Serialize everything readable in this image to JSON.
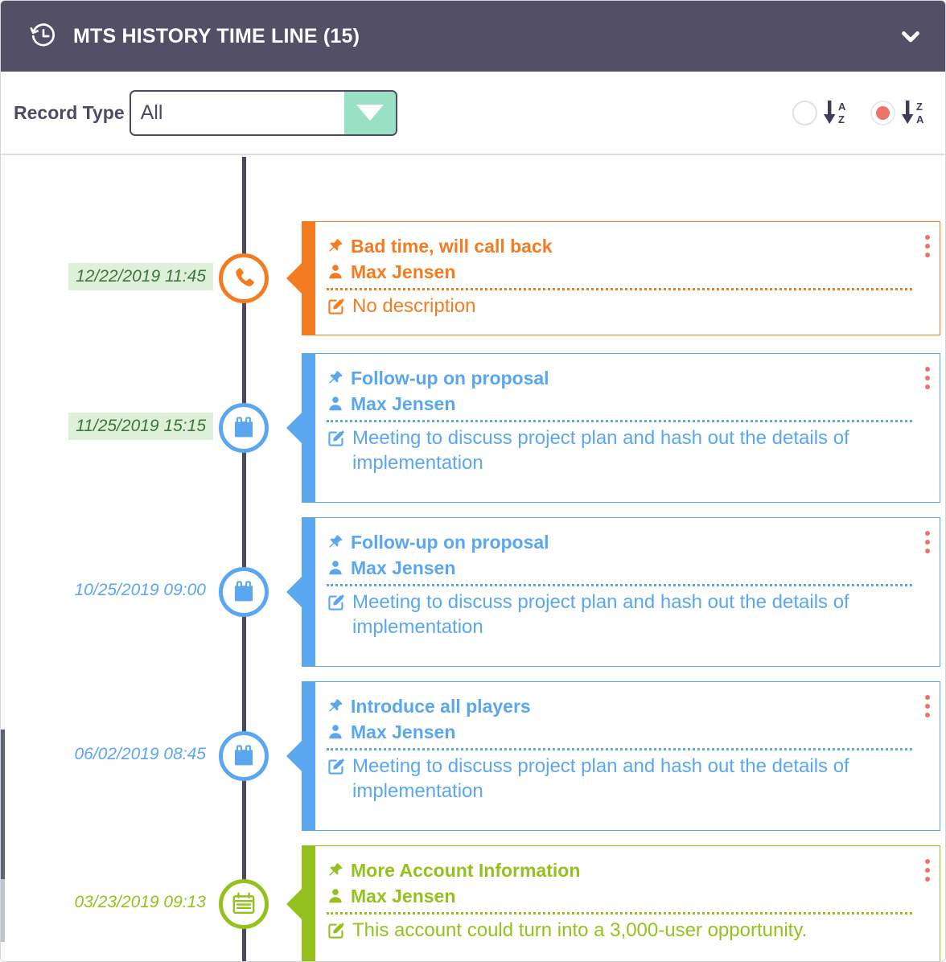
{
  "header": {
    "title": "MTS HISTORY TIME LINE (15)",
    "icon": "history-clock-icon",
    "collapse_icon": "chevron-down-icon",
    "bg_color": "#534f66"
  },
  "toolbar": {
    "record_type_label": "Record Type",
    "record_type_value": "All",
    "record_type_placeholder": "All",
    "dropdown_arrow_color": "#9ae0c4",
    "sort_options": [
      {
        "name": "sort-ascending",
        "label": "A\nZ",
        "top": "A",
        "bottom": "Z",
        "selected": false
      },
      {
        "name": "sort-descending",
        "label": "Z\nA",
        "top": "Z",
        "bottom": "A",
        "selected": true
      }
    ],
    "selected_radio_color": "#f0736a"
  },
  "timeline": {
    "axis_color": "#4b4860",
    "highlight_bg": "#dff0d8",
    "highlight_text": "#3c763d",
    "entries": [
      {
        "date": "12/22/2019 11:45",
        "date_highlighted": true,
        "color": "#f47c20",
        "icon": "phone-icon",
        "title": "Bad time, will call back",
        "user": "Max Jensen",
        "description": "No description"
      },
      {
        "date": "11/25/2019 15:15",
        "date_highlighted": true,
        "color": "#5aa7f0",
        "icon": "calendar-filled-icon",
        "title": "Follow-up on proposal",
        "user": "Max Jensen",
        "description": "Meeting to discuss project plan and hash out the details of implementation"
      },
      {
        "date": "10/25/2019 09:00",
        "date_highlighted": false,
        "color": "#5aa7f0",
        "icon": "calendar-filled-icon",
        "title": "Follow-up on proposal",
        "user": "Max Jensen",
        "description": "Meeting to discuss project plan and hash out the details of implementation"
      },
      {
        "date": "06/02/2019 08:45",
        "date_highlighted": false,
        "color": "#5aa7f0",
        "icon": "calendar-filled-icon",
        "title": "Introduce all players",
        "user": "Max Jensen",
        "description": "Meeting to discuss project plan and hash out the details of implementation"
      },
      {
        "date": "03/23/2019 09:13",
        "date_highlighted": false,
        "color": "#95c11f",
        "icon": "note-calendar-icon",
        "title": "More Account Information",
        "user": "Max Jensen",
        "description": "This account could turn into a 3,000-user opportunity."
      }
    ],
    "icons": {
      "title": "pin-icon",
      "user": "person-icon",
      "description": "edit-note-icon",
      "menu": "kebab-menu-icon"
    }
  }
}
